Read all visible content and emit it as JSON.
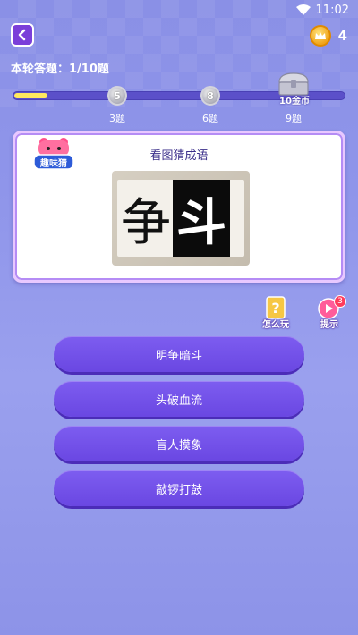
{
  "status": {
    "time": "11:02"
  },
  "header": {
    "coins": "4"
  },
  "round": {
    "label": "本轮答题：1/10题",
    "progress": 0.1
  },
  "milestones": [
    {
      "value": "5",
      "label": "3题"
    },
    {
      "value": "8",
      "label": "6题"
    }
  ],
  "chest": {
    "reward": "10金币",
    "label": "9题"
  },
  "card": {
    "title": "看图猜成语",
    "badge": "趣味猜",
    "puzzle": {
      "left_char": "争",
      "right_char": "斗"
    }
  },
  "tools": {
    "how_to_play": "怎么玩",
    "hint": "提示",
    "hint_count": "3"
  },
  "answers": [
    "明争暗斗",
    "头破血流",
    "盲人摸象",
    "敲锣打鼓"
  ]
}
